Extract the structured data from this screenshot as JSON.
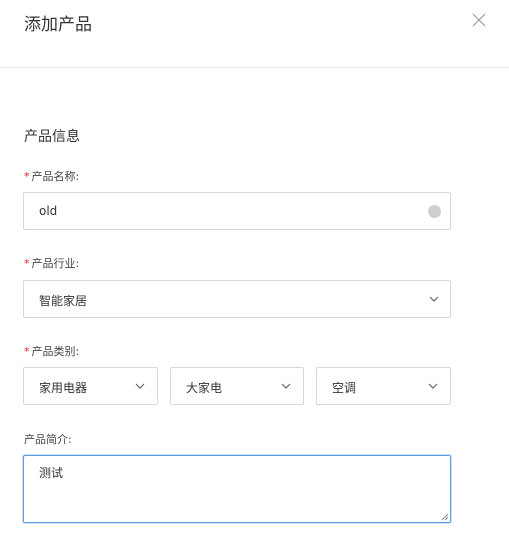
{
  "dialog": {
    "title": "添加产品",
    "close_icon": "close-icon"
  },
  "form": {
    "section_title": "产品信息",
    "product_name": {
      "required_mark": "*",
      "label": "产品名称:",
      "value": "old"
    },
    "industry": {
      "required_mark": "*",
      "label": "产品行业:",
      "value": "智能家居"
    },
    "category": {
      "required_mark": "*",
      "label": "产品类别:",
      "level1": "家用电器",
      "level2": "大家电",
      "level3": "空调"
    },
    "description": {
      "label": "产品简介:",
      "value": "测试"
    }
  },
  "colors": {
    "required": "#e02020",
    "focus_border": "#5b9ddb"
  }
}
